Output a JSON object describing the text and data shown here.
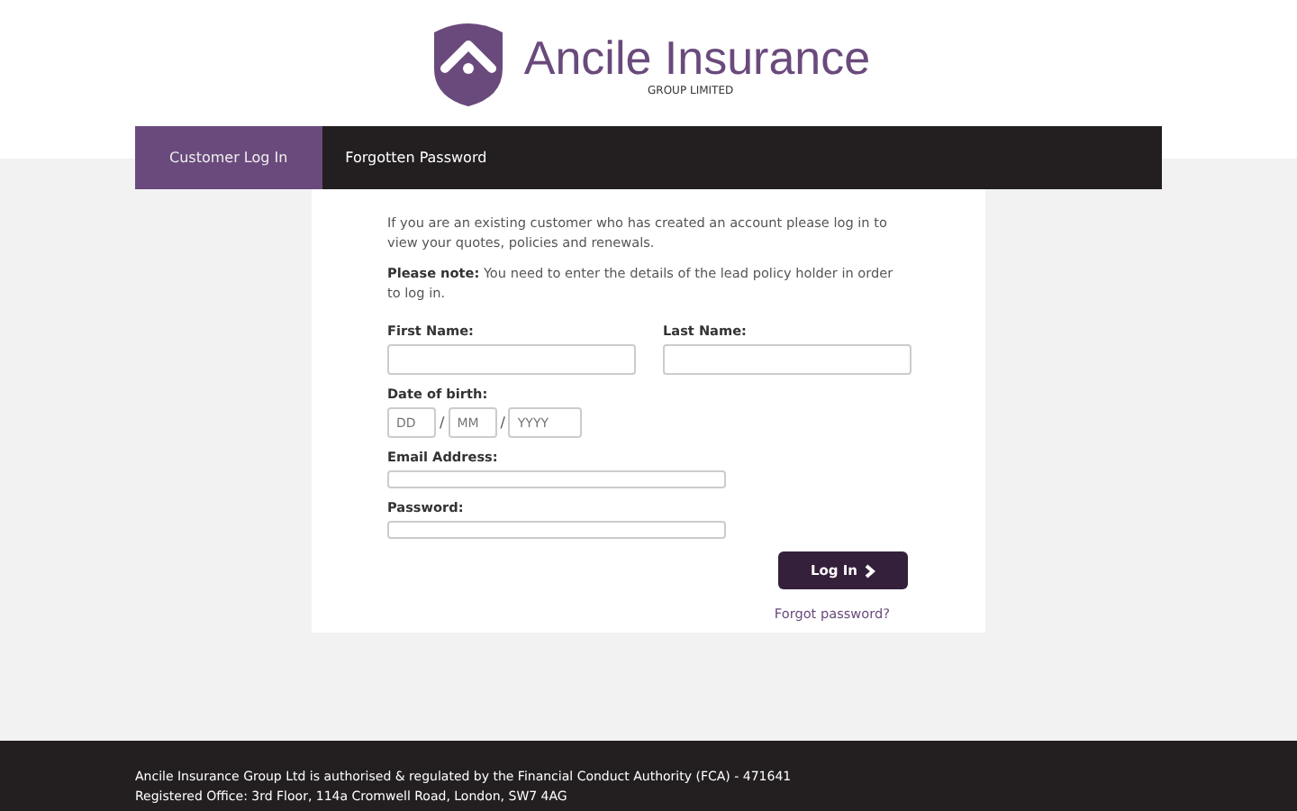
{
  "logo": {
    "name": "Ancile Insurance",
    "subtitle": "GROUP LIMITED"
  },
  "tabs": [
    {
      "label": "Customer Log In",
      "selected": true
    },
    {
      "label": "Forgotten Password",
      "selected": false
    }
  ],
  "intro": "If you are an existing customer who has created an account please log in to view your quotes, policies and renewals.",
  "note": "**Please note:** You need to enter the details of the lead policy holder in order to log in.",
  "fields": {
    "first_name": {
      "label": "First Name:"
    },
    "last_name": {
      "label": "Last Name:"
    },
    "dob": {
      "label": "Date of birth:",
      "parts": [
        {
          "placeholder": "DD"
        },
        {
          "placeholder": "MM"
        },
        {
          "placeholder": "YYYY"
        }
      ],
      "separator": "/"
    },
    "email": {
      "label": "Email Address:"
    },
    "password": {
      "label": "Password:"
    }
  },
  "login_button": "Log In",
  "forgot_link": "Forgot password?",
  "footer": [
    "Ancile Insurance Group Ltd is authorised & regulated by the Financial Conduct Authority (FCA) - 471641",
    "Registered Office: 3rd Floor, 114a Cromwell Road, London, SW7 4AG"
  ]
}
